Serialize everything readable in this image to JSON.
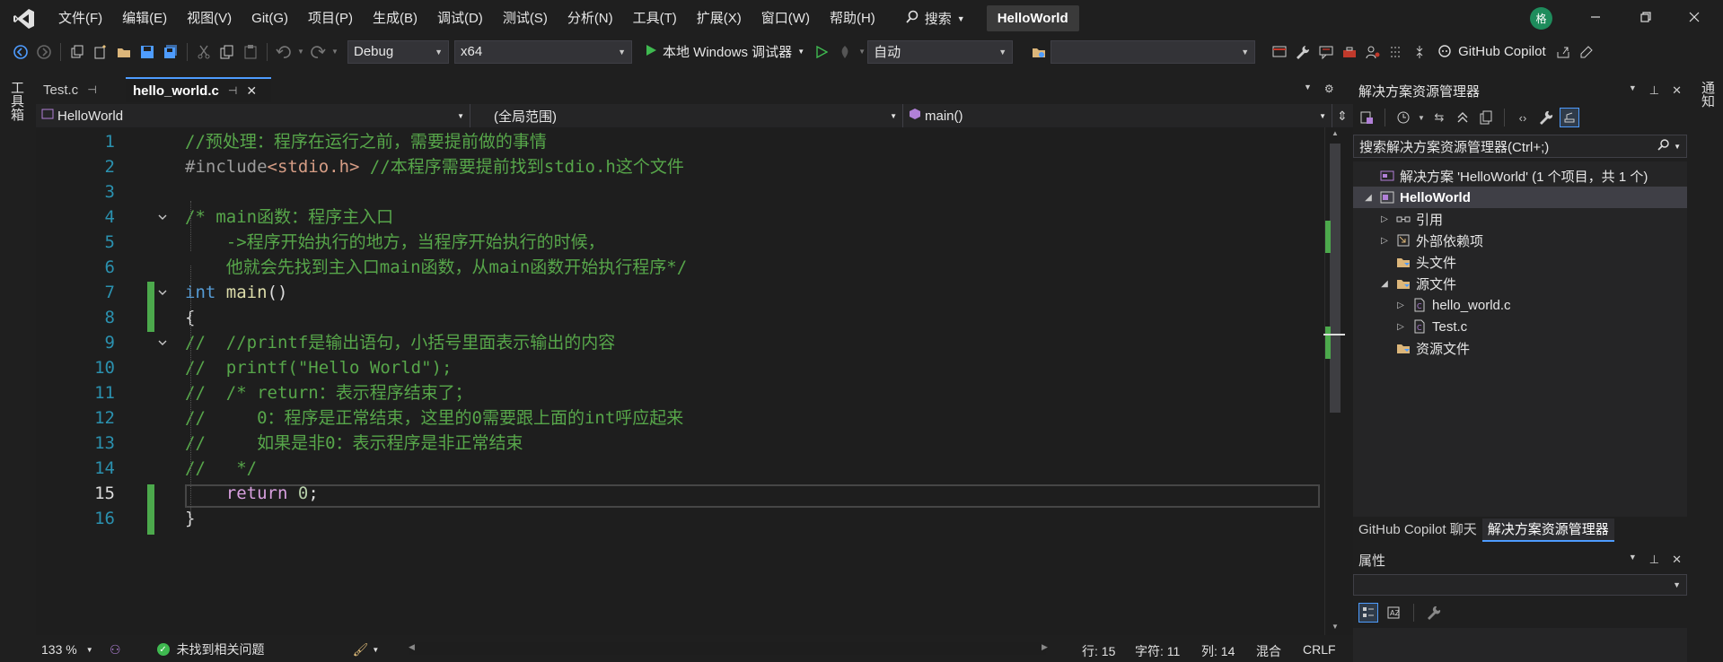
{
  "menu": {
    "items": [
      "文件(F)",
      "编辑(E)",
      "视图(V)",
      "Git(G)",
      "项目(P)",
      "生成(B)",
      "调试(D)",
      "测试(S)",
      "分析(N)",
      "工具(T)",
      "扩展(X)",
      "窗口(W)",
      "帮助(H)"
    ],
    "search_label": "搜索",
    "solution_name": "HelloWorld",
    "avatar_text": "格"
  },
  "toolbar": {
    "config": "Debug",
    "platform": "x64",
    "run_label": "本地 Windows 调试器",
    "run_target": "自动",
    "startup_combo": "",
    "copilot_label": "GitHub Copilot"
  },
  "side": {
    "toolbox_label": "工具箱",
    "notify_label": "通知"
  },
  "editor": {
    "tabs": [
      {
        "label": "Test.c",
        "active": false
      },
      {
        "label": "hello_world.c",
        "active": true
      }
    ],
    "nav": {
      "project": "HelloWorld",
      "scope": "(全局范围)",
      "member": "main()"
    },
    "current_line": 15,
    "lines": [
      {
        "n": "1",
        "fold": "",
        "tokens": [
          {
            "t": "//预处理：程序在运行之前，需要提前做的事情",
            "c": "comment"
          }
        ]
      },
      {
        "n": "2",
        "fold": "",
        "tokens": [
          {
            "t": "#include",
            "c": "pp"
          },
          {
            "t": "<stdio.h>",
            "c": "str"
          },
          {
            "t": " //本程序需要提前找到stdio.h这个文件",
            "c": "comment"
          }
        ]
      },
      {
        "n": "3",
        "fold": "",
        "tokens": []
      },
      {
        "n": "4",
        "fold": "v",
        "tokens": [
          {
            "t": "/* main函数：程序主入口",
            "c": "comment"
          }
        ]
      },
      {
        "n": "5",
        "fold": "",
        "tokens": [
          {
            "t": "    ->程序开始执行的地方，当程序开始执行的时候，",
            "c": "comment"
          }
        ]
      },
      {
        "n": "6",
        "fold": "",
        "tokens": [
          {
            "t": "    他就会先找到主入口main函数，从main函数开始执行程序*/",
            "c": "comment"
          }
        ]
      },
      {
        "n": "7",
        "fold": "v",
        "tokens": [
          {
            "t": "int",
            "c": "kw"
          },
          {
            "t": " ",
            "c": "plain"
          },
          {
            "t": "main",
            "c": "fn"
          },
          {
            "t": "()",
            "c": "plain"
          }
        ]
      },
      {
        "n": "8",
        "fold": "",
        "tokens": [
          {
            "t": "{",
            "c": "plain"
          }
        ]
      },
      {
        "n": "9",
        "fold": "v",
        "tokens": [
          {
            "t": "//  //printf是输出语句，小括号里面表示输出的内容",
            "c": "comment"
          }
        ]
      },
      {
        "n": "10",
        "fold": "",
        "tokens": [
          {
            "t": "//  printf(\"Hello World\");",
            "c": "comment"
          }
        ]
      },
      {
        "n": "11",
        "fold": "",
        "tokens": [
          {
            "t": "//  /* return：表示程序结束了；",
            "c": "comment"
          }
        ]
      },
      {
        "n": "12",
        "fold": "",
        "tokens": [
          {
            "t": "//     0：程序是正常结束，这里的0需要跟上面的int呼应起来",
            "c": "comment"
          }
        ]
      },
      {
        "n": "13",
        "fold": "",
        "tokens": [
          {
            "t": "//     如果是非0：表示程序是非正常结束",
            "c": "comment"
          }
        ]
      },
      {
        "n": "14",
        "fold": "",
        "tokens": [
          {
            "t": "//   */",
            "c": "comment"
          }
        ]
      },
      {
        "n": "15",
        "fold": "",
        "tokens": [
          {
            "t": "    ",
            "c": "plain"
          },
          {
            "t": "return",
            "c": "ctl"
          },
          {
            "t": " ",
            "c": "plain"
          },
          {
            "t": "0",
            "c": "num"
          },
          {
            "t": ";",
            "c": "plain"
          }
        ]
      },
      {
        "n": "16",
        "fold": "",
        "tokens": [
          {
            "t": "}",
            "c": "plain"
          }
        ]
      }
    ]
  },
  "status": {
    "zoom": "133 %",
    "issues": "未找到相关问题",
    "line": "行: 15",
    "char": "字符: 11",
    "col": "列: 14",
    "indent": "混合",
    "eol": "CRLF"
  },
  "solution_explorer": {
    "title": "解决方案资源管理器",
    "search_placeholder": "搜索解决方案资源管理器(Ctrl+;)",
    "tree": [
      {
        "label": "解决方案 'HelloWorld' (1 个项目，共 1 个)",
        "level": 0,
        "twisty": "",
        "icon": "solution-icon"
      },
      {
        "label": "HelloWorld",
        "level": 0,
        "twisty": "open",
        "icon": "project-icon",
        "selected": true
      },
      {
        "label": "引用",
        "level": 1,
        "twisty": "closed",
        "icon": "references-icon"
      },
      {
        "label": "外部依赖项",
        "level": 1,
        "twisty": "closed",
        "icon": "external-deps-icon"
      },
      {
        "label": "头文件",
        "level": 1,
        "twisty": "",
        "icon": "filter-folder-icon"
      },
      {
        "label": "源文件",
        "level": 1,
        "twisty": "open",
        "icon": "filter-folder-icon"
      },
      {
        "label": "hello_world.c",
        "level": 2,
        "twisty": "closed",
        "icon": "c-file-icon"
      },
      {
        "label": "Test.c",
        "level": 2,
        "twisty": "closed",
        "icon": "c-file-icon"
      },
      {
        "label": "资源文件",
        "level": 1,
        "twisty": "",
        "icon": "filter-folder-icon"
      }
    ],
    "bottom_tabs": [
      {
        "label": "GitHub Copilot 聊天",
        "active": false
      },
      {
        "label": "解决方案资源管理器",
        "active": true
      }
    ]
  },
  "properties": {
    "title": "属性"
  },
  "colors": {
    "accent": "#4e9cff",
    "comment": "#57a64a",
    "keyword": "#569cd6",
    "change_bar": "#4ca94c"
  }
}
